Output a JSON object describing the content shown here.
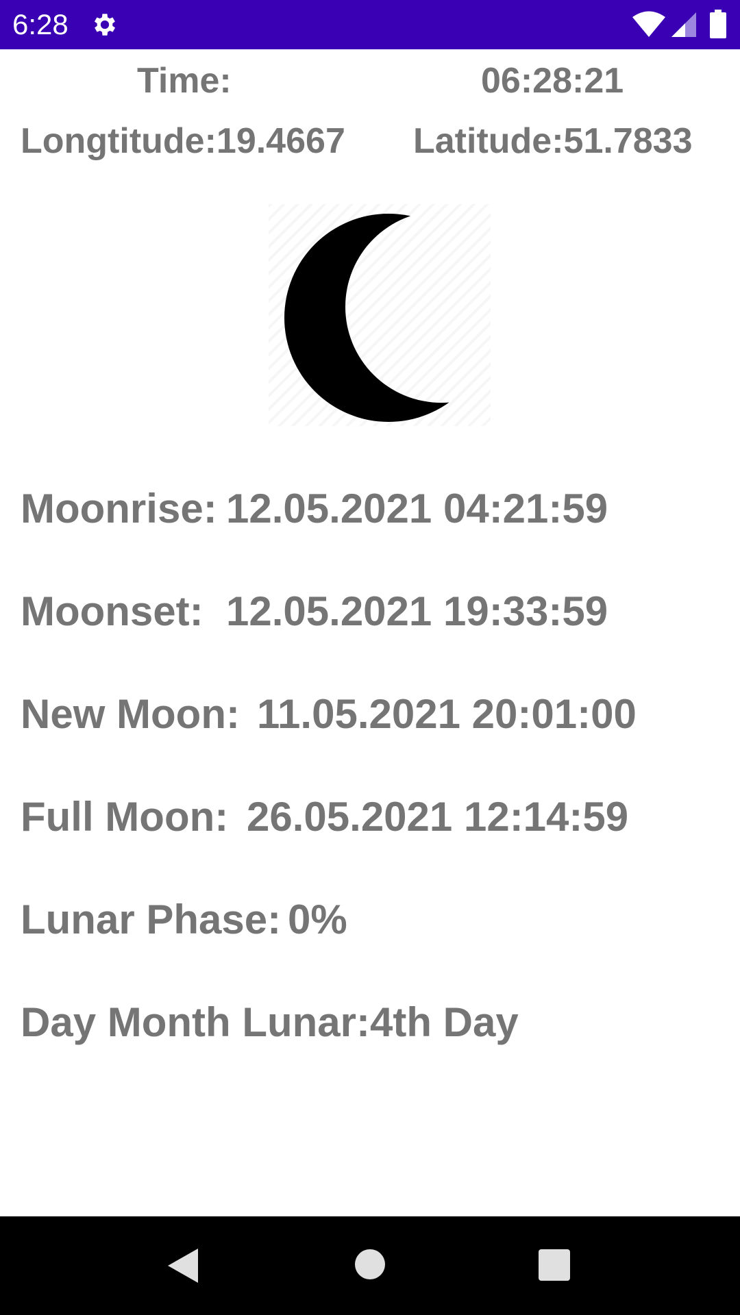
{
  "status_bar": {
    "time": "6:28",
    "background": "#3a00b3",
    "icons": [
      "gear-icon",
      "wifi-icon",
      "cell-signal-icon",
      "battery-icon"
    ]
  },
  "header": {
    "time_label": "Time:",
    "time_value": "06:28:21",
    "longitude_text": "Longtitude:19.4667",
    "latitude_text": "Latitude:51.7833"
  },
  "moon_image": {
    "icon": "crescent-moon-icon"
  },
  "details": {
    "moonrise_label": "Moonrise:",
    "moonrise_value": "12.05.2021 04:21:59",
    "moonset_label": "Moonset:",
    "moonset_value": "12.05.2021 19:33:59",
    "new_moon_label": "New Moon:",
    "new_moon_value": "11.05.2021 20:01:00",
    "full_moon_label": "Full Moon:",
    "full_moon_value": "26.05.2021 12:14:59",
    "lunar_phase_label": "Lunar Phase:",
    "lunar_phase_value": "0%",
    "day_month_lunar_label": "Day Month Lunar:",
    "day_month_lunar_value": "4th Day"
  },
  "text_color": "#757575",
  "nav_bar": {
    "icons": [
      "back-icon",
      "home-icon",
      "recents-icon"
    ]
  }
}
